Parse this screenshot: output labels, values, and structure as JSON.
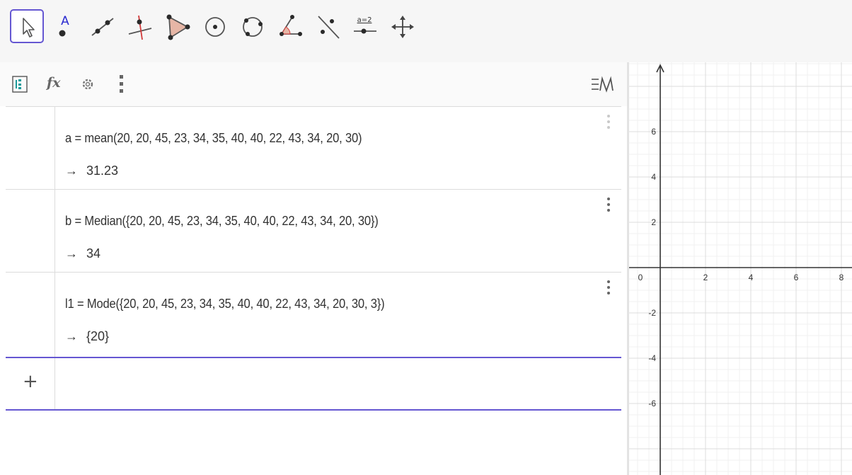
{
  "toolbar": {
    "tools": [
      {
        "name": "move-tool",
        "active": true
      },
      {
        "name": "point-tool",
        "label": "A"
      },
      {
        "name": "line-tool"
      },
      {
        "name": "perpendicular-line-tool"
      },
      {
        "name": "polygon-tool"
      },
      {
        "name": "circle-center-point-tool"
      },
      {
        "name": "circle-three-points-tool"
      },
      {
        "name": "angle-tool"
      },
      {
        "name": "reflect-about-line-tool"
      },
      {
        "name": "slider-tool",
        "label": "a=2"
      },
      {
        "name": "move-graphics-view-tool"
      }
    ]
  },
  "algebra": {
    "header": {
      "fx_label": "fx",
      "description_toggle": "ΞN"
    },
    "rows": [
      {
        "input": "a  =  mean(20, 20, 45, 23, 34, 35, 40, 40, 22, 43, 34, 20, 30)",
        "arrow": "→",
        "output": "31.23"
      },
      {
        "input": "b  =  Median({20, 20, 45, 23, 34, 35, 40, 40, 22, 43, 34, 20, 30})",
        "arrow": "→",
        "output": "34"
      },
      {
        "input": "l1  =  Mode({20, 20, 45, 23, 34, 35, 40, 40, 22, 43, 34, 20, 30, 3})",
        "arrow": "→",
        "output": "{20}"
      }
    ],
    "add_label": "+"
  },
  "graphics": {
    "x_ticks": [
      "0",
      "2",
      "4",
      "6",
      "8"
    ],
    "y_ticks": [
      "6",
      "4",
      "2",
      "-2",
      "-4",
      "-6"
    ]
  },
  "colors": {
    "accent": "#6557d2",
    "toolbar_bg": "#f6f6f6",
    "grid": "#e6e6e6",
    "axis": "#333333"
  }
}
